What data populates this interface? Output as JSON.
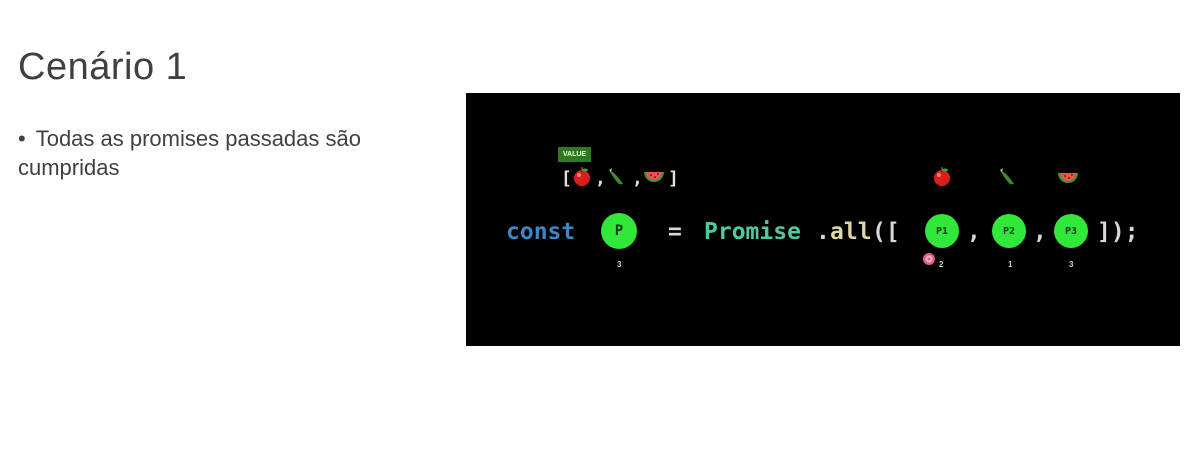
{
  "slide": {
    "title": "Cenário 1",
    "bullet": "Todas as promises passadas são cumpridas"
  },
  "code": {
    "keyword": "const",
    "equals": "=",
    "class_name": "Promise",
    "dot": ".",
    "method": "all",
    "open": "([",
    "comma1": ",",
    "comma2": ",",
    "close": "]);"
  },
  "promises": {
    "result": {
      "label": "P",
      "index": "3"
    },
    "p1": {
      "label": "P1",
      "index": "2"
    },
    "p2": {
      "label": "P2",
      "index": "1"
    },
    "p3": {
      "label": "P3",
      "index": "3"
    }
  },
  "value_array": {
    "tag": "VALUE",
    "open": "[",
    "sep1": ",",
    "sep2": ",",
    "close": "]"
  },
  "fruits": [
    "apple-icon",
    "cucumber-icon",
    "watermelon-icon"
  ],
  "colors": {
    "badge": "#31e83a",
    "keyword": "#3d86c8",
    "class": "#4ec9a4",
    "method": "#ddd8a6",
    "panel": "#000000"
  }
}
